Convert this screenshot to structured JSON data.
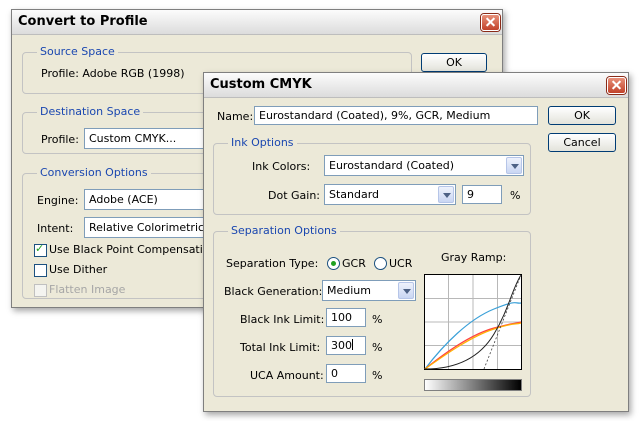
{
  "convert": {
    "title": "Convert to Profile",
    "ok_label": "OK",
    "source": {
      "legend": "Source Space",
      "profile_text": "Profile:  Adobe RGB (1998)"
    },
    "destination": {
      "legend": "Destination Space",
      "profile_label": "Profile:",
      "profile_value": "Custom CMYK..."
    },
    "conversion": {
      "legend": "Conversion Options",
      "engine_label": "Engine:",
      "engine_value": "Adobe (ACE)",
      "intent_label": "Intent:",
      "intent_value": "Relative Colorimetric",
      "black_point_label": "Use Black Point Compensation",
      "black_point_checked": true,
      "dither_label": "Use Dither",
      "dither_checked": false,
      "flatten_label": "Flatten Image",
      "flatten_enabled": false
    }
  },
  "custom": {
    "title": "Custom CMYK",
    "name_label": "Name:",
    "name_value": "Eurostandard (Coated), 9%, GCR, Medium",
    "ok_label": "OK",
    "cancel_label": "Cancel",
    "ink": {
      "legend": "Ink Options",
      "colors_label": "Ink Colors:",
      "colors_value": "Eurostandard (Coated)",
      "dotgain_label": "Dot Gain:",
      "dotgain_value": "Standard",
      "dotgain_amount": "9",
      "dotgain_unit": "%"
    },
    "separation": {
      "legend": "Separation Options",
      "type_label": "Separation Type:",
      "gcr_label": "GCR",
      "ucr_label": "UCR",
      "selected_type": "GCR",
      "black_gen_label": "Black Generation:",
      "black_gen_value": "Medium",
      "black_limit_label": "Black Ink Limit:",
      "black_limit_value": "100",
      "black_limit_unit": "%",
      "total_limit_label": "Total Ink Limit:",
      "total_limit_value": "300",
      "total_limit_unit": "%",
      "uca_label": "UCA Amount:",
      "uca_value": "0",
      "uca_unit": "%",
      "gray_ramp_label": "Gray Ramp:"
    },
    "curve_colors": {
      "cyan": "#3aa0d8",
      "magenta": "#ff4040",
      "yellow": "#ffb000",
      "black": "#202020"
    }
  }
}
